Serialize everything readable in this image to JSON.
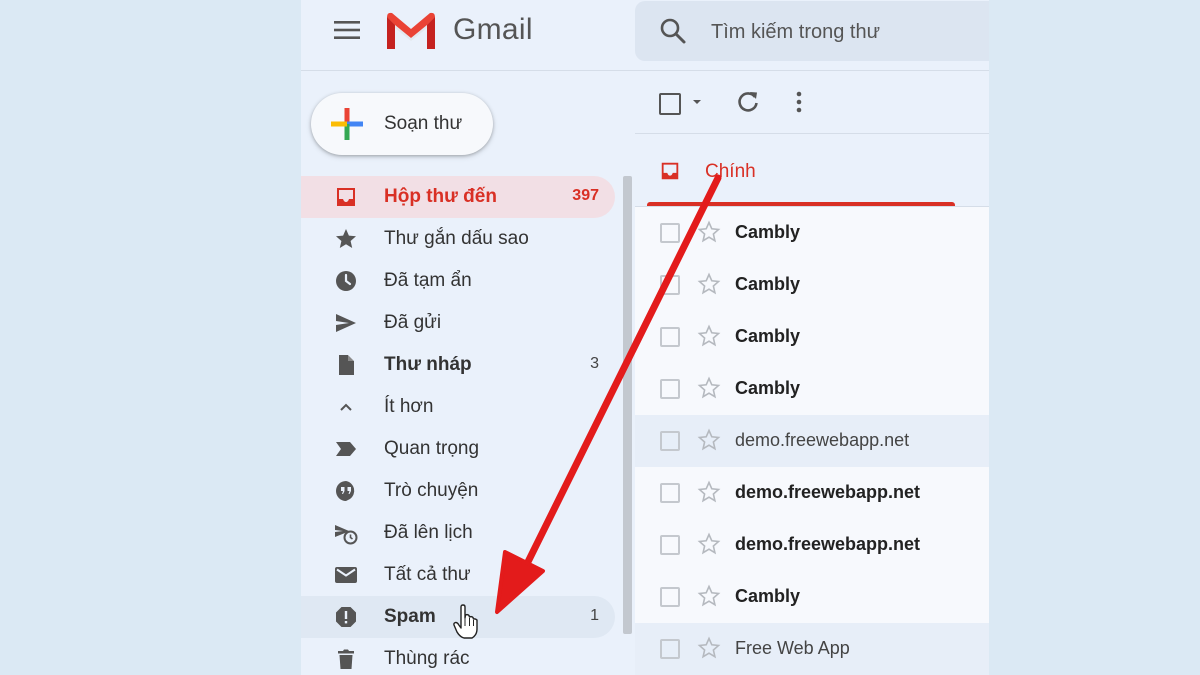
{
  "header": {
    "brand": "Gmail",
    "search_placeholder": "Tìm kiếm trong thư"
  },
  "compose": {
    "label": "Soạn thư"
  },
  "sidebar": {
    "items": [
      {
        "label": "Hộp thư đến",
        "count": "397",
        "icon": "inbox-icon"
      },
      {
        "label": "Thư gắn dấu sao",
        "count": "",
        "icon": "star-icon"
      },
      {
        "label": "Đã tạm ẩn",
        "count": "",
        "icon": "clock-icon"
      },
      {
        "label": "Đã gửi",
        "count": "",
        "icon": "send-icon"
      },
      {
        "label": "Thư nháp",
        "count": "3",
        "icon": "draft-icon"
      },
      {
        "label": "Ít hơn",
        "count": "",
        "icon": "chevron-up-icon"
      },
      {
        "label": "Quan trọng",
        "count": "",
        "icon": "important-icon"
      },
      {
        "label": "Trò chuyện",
        "count": "",
        "icon": "chat-icon"
      },
      {
        "label": "Đã lên lịch",
        "count": "",
        "icon": "scheduled-icon"
      },
      {
        "label": "Tất cả thư",
        "count": "",
        "icon": "mail-icon"
      },
      {
        "label": "Spam",
        "count": "1",
        "icon": "spam-icon"
      },
      {
        "label": "Thùng rác",
        "count": "",
        "icon": "trash-icon"
      }
    ]
  },
  "tabs": {
    "primary_label": "Chính"
  },
  "emails": [
    {
      "sender": "Cambly",
      "unread": true
    },
    {
      "sender": "Cambly",
      "unread": true
    },
    {
      "sender": "Cambly",
      "unread": true
    },
    {
      "sender": "Cambly",
      "unread": true
    },
    {
      "sender": "demo.freewebapp.net",
      "unread": false
    },
    {
      "sender": "demo.freewebapp.net",
      "unread": true
    },
    {
      "sender": "demo.freewebapp.net",
      "unread": true
    },
    {
      "sender": "Cambly",
      "unread": true
    },
    {
      "sender": "Free Web App",
      "unread": false
    }
  ],
  "colors": {
    "accent_red": "#d93025",
    "annotation_arrow": "#e31b1b",
    "background": "#dbe9f4"
  }
}
